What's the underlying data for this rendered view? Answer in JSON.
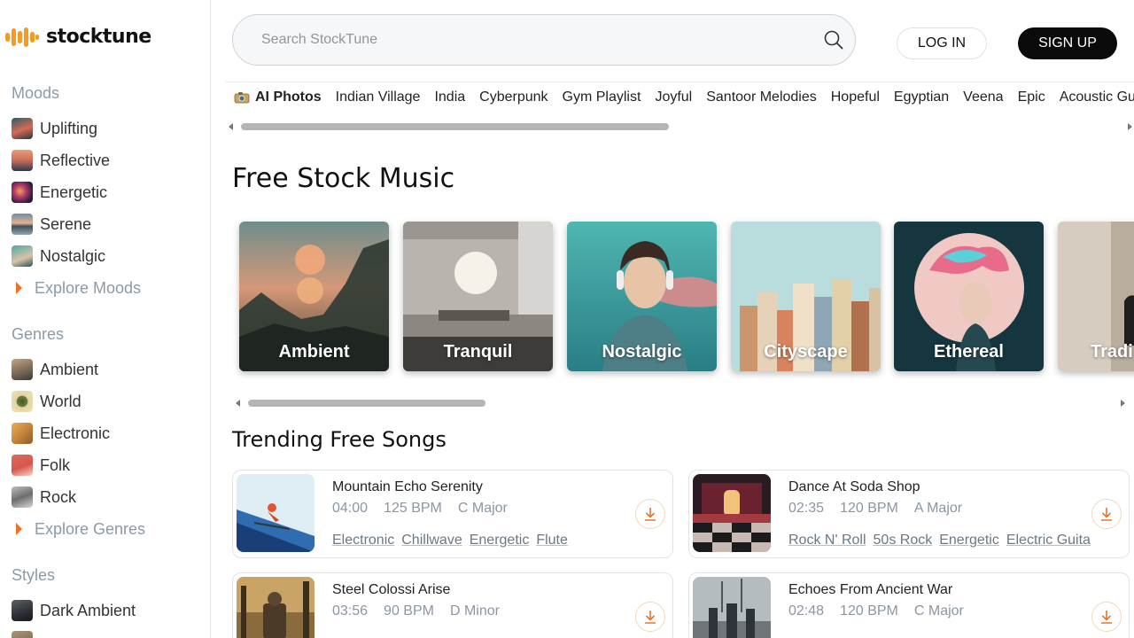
{
  "brand": {
    "name": "stocktune"
  },
  "search": {
    "placeholder": "Search StockTune"
  },
  "header": {
    "login": "LOG IN",
    "signup": "SIGN UP"
  },
  "sidebar": {
    "moods": {
      "title": "Moods",
      "items": [
        {
          "label": "Uplifting"
        },
        {
          "label": "Reflective"
        },
        {
          "label": "Energetic"
        },
        {
          "label": "Serene"
        },
        {
          "label": "Nostalgic"
        }
      ],
      "explore": "Explore Moods"
    },
    "genres": {
      "title": "Genres",
      "items": [
        {
          "label": "Ambient"
        },
        {
          "label": "World"
        },
        {
          "label": "Electronic"
        },
        {
          "label": "Folk"
        },
        {
          "label": "Rock"
        }
      ],
      "explore": "Explore Genres"
    },
    "styles": {
      "title": "Styles",
      "items": [
        {
          "label": "Dark Ambient"
        }
      ]
    }
  },
  "tags": [
    "AI Photos",
    "Indian Village",
    "India",
    "Cyberpunk",
    "Gym Playlist",
    "Joyful",
    "Santoor Melodies",
    "Hopeful",
    "Egyptian",
    "Veena",
    "Epic",
    "Acoustic Gu"
  ],
  "main": {
    "title": "Free Stock Music",
    "categories": [
      "Ambient",
      "Tranquil",
      "Nostalgic",
      "Cityscape",
      "Ethereal",
      "Tradi"
    ],
    "trending_title": "Trending Free Songs"
  },
  "songs": [
    {
      "title": "Mountain Echo Serenity",
      "duration": "04:00",
      "bpm": "125 BPM",
      "key": "C Major",
      "tags": [
        "Electronic",
        "Chillwave",
        "Energetic",
        "Flute"
      ]
    },
    {
      "title": "Dance At Soda Shop",
      "duration": "02:35",
      "bpm": "120 BPM",
      "key": "A Major",
      "tags": [
        "Rock N' Roll",
        "50s Rock",
        "Energetic",
        "Electric Guita"
      ]
    },
    {
      "title": "Steel Colossi Arise",
      "duration": "03:56",
      "bpm": "90 BPM",
      "key": "D Minor",
      "tags": []
    },
    {
      "title": "Echoes From Ancient War",
      "duration": "02:48",
      "bpm": "120 BPM",
      "key": "C Major",
      "tags": []
    }
  ],
  "colors": {
    "accent": "#e8732a",
    "logo": "#f59a23",
    "muted": "#8a9aa8"
  }
}
